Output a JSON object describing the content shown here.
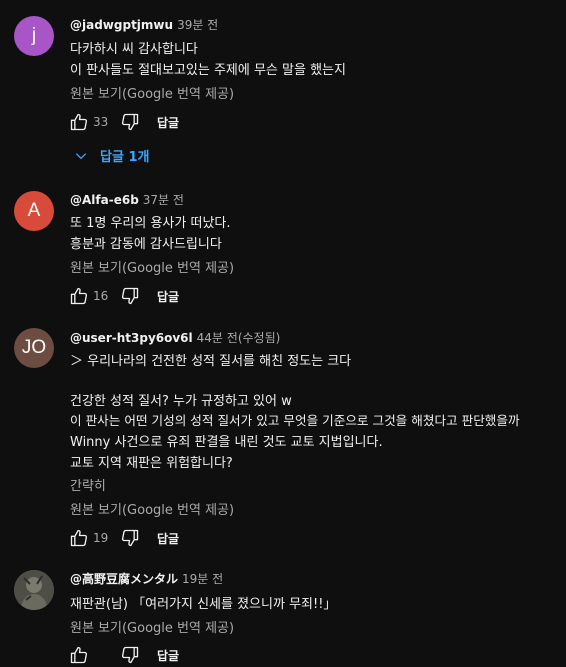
{
  "comments": [
    {
      "avatar_letter": "j",
      "avatar_color": "#a855c8",
      "handle": "@jadwgptjmwu",
      "time": "39분 전",
      "lines": [
        "다카하시 씨 감사합니다",
        "이 판사들도 절대보고있는 주제에 무슨 말을 했는지"
      ],
      "translate_link": "원본 보기(Google 번역 제공)",
      "like_count": "33",
      "reply_label": "답글",
      "replies_toggle": "답글 1개"
    },
    {
      "avatar_letter": "A",
      "avatar_color": "#d84a3a",
      "handle": "@Alfa-e6b",
      "time": "37분 전",
      "lines": [
        "또 1명 우리의 용사가 떠났다.",
        "흥분과 감동에 감사드립니다"
      ],
      "translate_link": "원본 보기(Google 번역 제공)",
      "like_count": "16",
      "reply_label": "답글"
    },
    {
      "avatar_letter": "JO",
      "avatar_color": "#6d4c41",
      "handle": "@user-ht3py6ov6l",
      "time": "44분 전(수정됨)",
      "lines": [
        "＞ 우리나라의 건전한 성적 질서를 해친 정도는 크다",
        "",
        "건강한 성적 질서? 누가 규정하고 있어 w",
        "이 판사는 어떤 기성의 성적 질서가 있고 무엇을 기준으로 그것을 해쳤다고 판단했을까",
        "Winny 사건으로 유죄 판결을 내린 것도 교토 지법입니다.",
        "교토 지역 재판은 위험합니다?"
      ],
      "show_less": "간략히",
      "translate_link": "원본 보기(Google 번역 제공)",
      "like_count": "19",
      "reply_label": "답글"
    },
    {
      "avatar_color": "#5a5a52",
      "handle": "@高野豆腐メンタル",
      "time": "19분 전",
      "lines": [
        "재판관(남) 「여러가지 신세를 졌으니까 무죄!!」"
      ],
      "translate_link": "원본 보기(Google 번역 제공)",
      "reply_label": "답글"
    }
  ],
  "icons": {
    "like": "thumbs-up-icon",
    "dislike": "thumbs-down-icon",
    "expand": "chevron-down-icon"
  },
  "colors": {
    "background": "#0f0f0f",
    "text_primary": "#f1f1f1",
    "text_secondary": "#aaaaaa",
    "link_blue": "#3ea6ff"
  }
}
